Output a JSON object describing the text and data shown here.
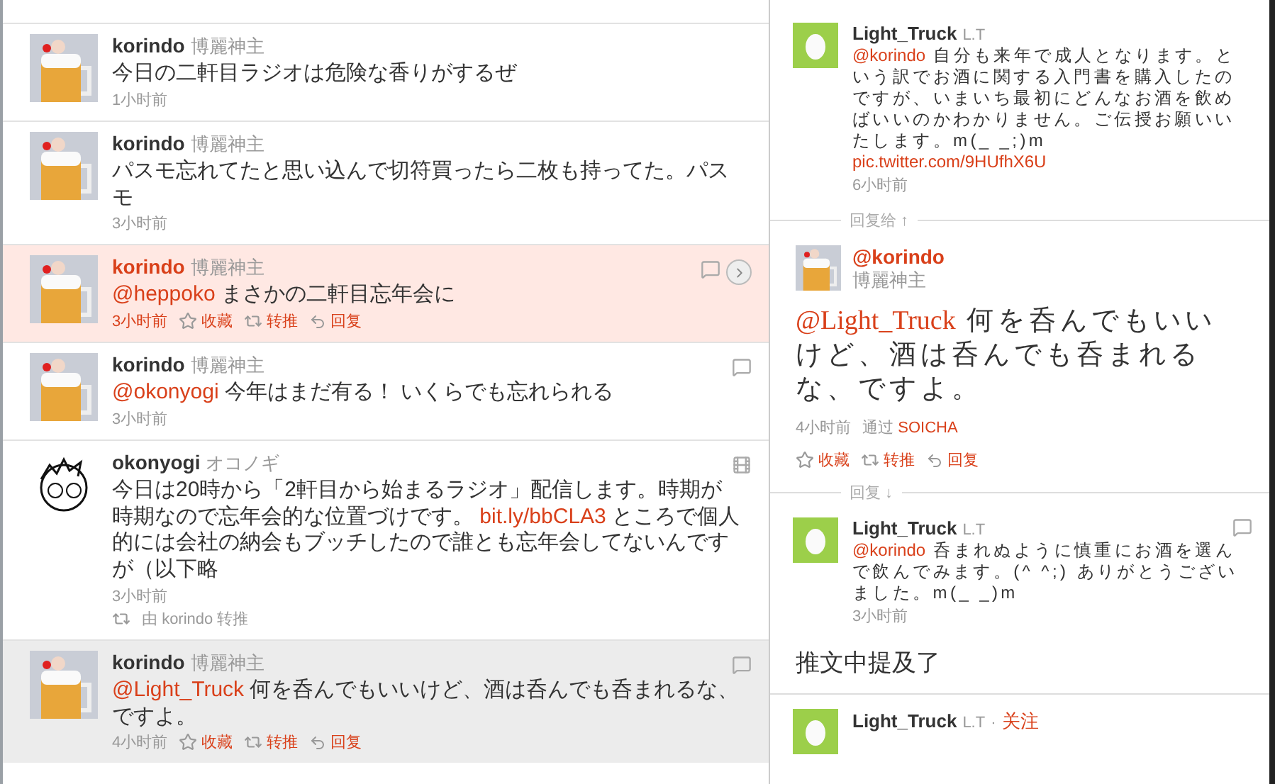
{
  "timeline": [
    {
      "screen_name": "korindo",
      "full_name": "博麗神主",
      "avatar": {
        "kind": "beer"
      },
      "parts": [
        {
          "kind": "text",
          "text": "今日の二軒目ラジオは危険な香りがするぜ"
        }
      ],
      "time": "1小时前",
      "hovered": false,
      "selected": false
    },
    {
      "screen_name": "korindo",
      "full_name": "博麗神主",
      "avatar": {
        "kind": "beer"
      },
      "parts": [
        {
          "kind": "text",
          "text": "パスモ忘れてたと思い込んで切符買ったら二枚も持ってた。パスモ"
        }
      ],
      "time": "3小时前",
      "hovered": false,
      "selected": false
    },
    {
      "screen_name": "korindo",
      "full_name": "博麗神主",
      "avatar": {
        "kind": "beer"
      },
      "parts": [
        {
          "kind": "mention",
          "text": "@heppoko"
        },
        {
          "kind": "text",
          "text": " まさかの二軒目忘年会に"
        }
      ],
      "time": "3小时前",
      "hovered": true,
      "selected": false,
      "icons": [
        {
          "kind": "reply"
        },
        {
          "kind": "open"
        }
      ],
      "actions": [
        {
          "kind": "favorite",
          "label": "收藏"
        },
        {
          "kind": "retweet",
          "label": "转推"
        },
        {
          "kind": "reply",
          "label": "回复"
        }
      ]
    },
    {
      "screen_name": "korindo",
      "full_name": "博麗神主",
      "avatar": {
        "kind": "beer"
      },
      "parts": [
        {
          "kind": "mention",
          "text": "@okonyogi"
        },
        {
          "kind": "text",
          "text": " 今年はまだ有る！ いくらでも忘れられる"
        }
      ],
      "time": "3小时前",
      "hovered": false,
      "selected": false,
      "icons": [
        {
          "kind": "reply"
        }
      ]
    },
    {
      "screen_name": "okonyogi",
      "full_name": "オコノギ",
      "avatar": {
        "kind": "sketch"
      },
      "parts": [
        {
          "kind": "text",
          "text": "今日は20時から「2軒目から始まるラジオ」配信します。時期が時期なので忘年会的な位置づけです。 "
        },
        {
          "kind": "link",
          "text": "bit.ly/bbCLA3"
        },
        {
          "kind": "text",
          "text": " ところで個人的には会社の納会もブッチしたので誰とも忘年会してないんですが（以下略"
        }
      ],
      "time": "3小时前",
      "hovered": false,
      "selected": false,
      "icons": [
        {
          "kind": "media"
        }
      ],
      "retweeted_by": {
        "prefix": "由",
        "user": "korindo",
        "suffix": "转推"
      }
    },
    {
      "screen_name": "korindo",
      "full_name": "博麗神主",
      "avatar": {
        "kind": "beer"
      },
      "parts": [
        {
          "kind": "mention",
          "text": "@Light_Truck"
        },
        {
          "kind": "text",
          "text": " 何を呑んでもいいけど、酒は呑んでも呑まれるな、ですよ。"
        }
      ],
      "time": "4小时前",
      "hovered": false,
      "selected": true,
      "icons": [
        {
          "kind": "reply"
        }
      ],
      "actions": [
        {
          "kind": "favorite",
          "label": "收藏"
        },
        {
          "kind": "retweet",
          "label": "转推"
        },
        {
          "kind": "reply",
          "label": "回复"
        }
      ]
    }
  ],
  "detail": {
    "parent": {
      "screen_name": "Light_Truck",
      "full_name": "L.T",
      "avatar": {
        "kind": "egg"
      },
      "parts": [
        {
          "kind": "mention",
          "text": "@korindo"
        },
        {
          "kind": "text",
          "text": " 自分も来年で成人となります。という訳でお酒に関する入門書を購入したのですが、いまいち最初にどんなお酒を飲めばいいのかわかりません。ご伝授お願いいたします。m(_ _;)m "
        },
        {
          "kind": "link",
          "text": "pic.twitter.com/9HUfhX6U"
        }
      ],
      "time": "6小时前"
    },
    "in_reply_label": "回复给 ↑",
    "main": {
      "screen_name": "@korindo",
      "full_name": "博麗神主",
      "avatar": {
        "kind": "beer"
      },
      "parts": [
        {
          "kind": "mention",
          "text": "@Light_Truck"
        },
        {
          "kind": "text",
          "text": " 何を呑んでもいいけど、酒は呑んでも呑まれるな、ですよ。"
        }
      ],
      "time": "4小时前",
      "via": "通过",
      "source": "SOICHA",
      "actions": [
        {
          "kind": "favorite",
          "label": "收藏"
        },
        {
          "kind": "retweet",
          "label": "转推"
        },
        {
          "kind": "reply",
          "label": "回复"
        }
      ]
    },
    "replies_label": "回复 ↓",
    "replies": [
      {
        "screen_name": "Light_Truck",
        "full_name": "L.T",
        "avatar": {
          "kind": "egg"
        },
        "parts": [
          {
            "kind": "mention",
            "text": "@korindo"
          },
          {
            "kind": "text",
            "text": " 呑まれぬように慎重にお酒を選んで飲んでみます。(^ ^;) ありがとうございました。m(_ _)m"
          }
        ],
        "time": "3小时前",
        "icons": [
          {
            "kind": "reply"
          }
        ]
      }
    ],
    "mentioned_heading": "推文中提及了",
    "mentioned_users": [
      {
        "screen_name": "Light_Truck",
        "full_name": "L.T",
        "separator": "·",
        "follow": "关注",
        "avatar": {
          "kind": "egg"
        }
      }
    ]
  }
}
